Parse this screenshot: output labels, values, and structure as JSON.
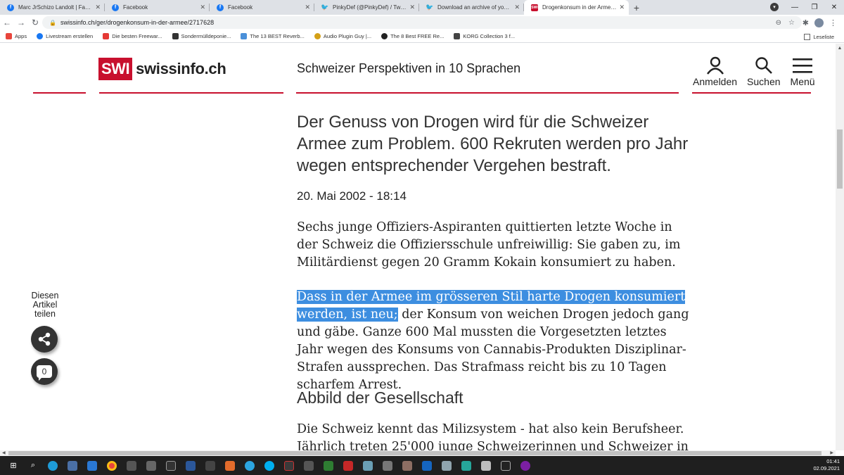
{
  "browser": {
    "tabs": [
      {
        "label": "Marc JrSchizo Landolt | Facebook",
        "fav": "fb"
      },
      {
        "label": "Facebook",
        "fav": "fb"
      },
      {
        "label": "Facebook",
        "fav": "fb"
      },
      {
        "label": "PinkyDef (@PinkyDef) / Twitter",
        "fav": "tw"
      },
      {
        "label": "Download an archive of your dat",
        "fav": "tw"
      },
      {
        "label": "Drogenkonsum in der Armee - S",
        "fav": "swi",
        "active": true
      }
    ],
    "url": "swissinfo.ch/ger/drogenkonsum-in-der-armee/2717628",
    "bookmarks": [
      {
        "label": "Apps",
        "color": "#e8453c"
      },
      {
        "label": "Livestream erstellen",
        "color": "#1877f2"
      },
      {
        "label": "Die besten Freewar...",
        "color": "#e53935"
      },
      {
        "label": "Sondermülldeponie...",
        "color": "#333333"
      },
      {
        "label": "The 13 BEST Reverb...",
        "color": "#4a90d9"
      },
      {
        "label": "Audio Plugin Guy |...",
        "color": "#d4a017"
      },
      {
        "label": "The 8 Best FREE Re...",
        "color": "#222222"
      },
      {
        "label": "KORG Collection 3 f...",
        "color": "#444444"
      }
    ],
    "reading_list": "Leseliste"
  },
  "site": {
    "logo_box": "SWI",
    "logo_text": "swissinfo.ch",
    "tagline": "Schweizer Perspektiven in 10 Sprachen",
    "actions": {
      "login": "Anmelden",
      "search": "Suchen",
      "menu": "Menü"
    },
    "brand_color": "#c8102e"
  },
  "article": {
    "lead": "Der Genuss von Drogen wird für die Schweizer Armee zum Problem. 600 Rekruten werden pro Jahr wegen entsprechender Vergehen bestraft.",
    "date": "20. Mai 2002 - 18:14",
    "p1": "Sechs junge Offiziers-Aspiranten quittierten letzte Woche in der Schweiz die Offiziersschule unfreiwillig: Sie gaben zu, im Militärdienst gegen 20 Gramm Kokain konsumiert zu haben.",
    "p2_highlighted": "Dass in der Armee im grösseren Stil harte Drogen konsumiert werden, ist neu;",
    "p2_rest": " der Konsum von weichen Drogen jedoch gang und gäbe. Ganze 600 Mal mussten die Vorgesetzten letztes Jahr wegen des Konsums von Cannabis-Produkten Disziplinar-Strafen aussprechen. Das Strafmass reicht bis zu 10 Tagen scharfem Arrest.",
    "subhead": "Abbild der Gesellschaft",
    "p3": "Die Schweiz kennt das Milizsystem - hat also kein Berufsheer. Jährlich treten 25'000 junge Schweizerinnen und Schweizer in"
  },
  "share": {
    "label": "Diesen Artikel teilen",
    "comment_count": "0"
  },
  "taskbar": {
    "time": "01:41",
    "date": "02.09.2021"
  }
}
